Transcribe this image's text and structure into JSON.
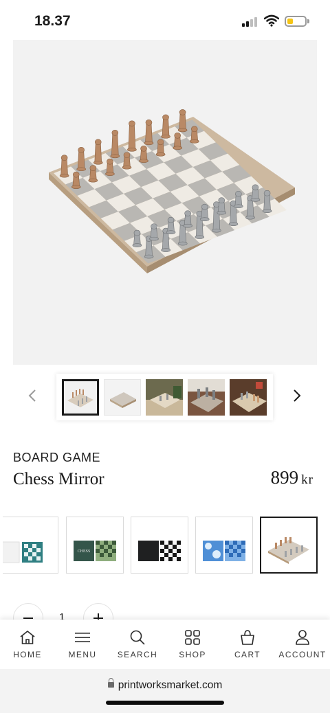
{
  "status_bar": {
    "time": "18.37",
    "battery_color": "#f5c516"
  },
  "product": {
    "category": "BOARD GAME",
    "title": "Chess Mirror",
    "price": "899",
    "currency": "kr"
  },
  "gallery": {
    "thumbnails": [
      "chess-board-front",
      "chess-board-box",
      "chess-board-table",
      "chess-board-closeup",
      "chess-board-lifestyle"
    ],
    "active_index": 0
  },
  "variants": {
    "items": [
      "checkers-teal",
      "chess-green",
      "chess-black",
      "chess-blue",
      "chess-mirror"
    ],
    "active_index": 4
  },
  "quantity": {
    "value": "1",
    "minus_icon": "minus-icon",
    "plus_icon": "plus-icon"
  },
  "bottom_nav": {
    "items": [
      {
        "label": "HOME",
        "icon": "home-icon"
      },
      {
        "label": "MENU",
        "icon": "menu-icon"
      },
      {
        "label": "SEARCH",
        "icon": "search-icon"
      },
      {
        "label": "SHOP",
        "icon": "grid-icon"
      },
      {
        "label": "CART",
        "icon": "bag-icon"
      },
      {
        "label": "ACCOUNT",
        "icon": "user-icon"
      }
    ]
  },
  "browser": {
    "url": "printworksmarket.com"
  }
}
